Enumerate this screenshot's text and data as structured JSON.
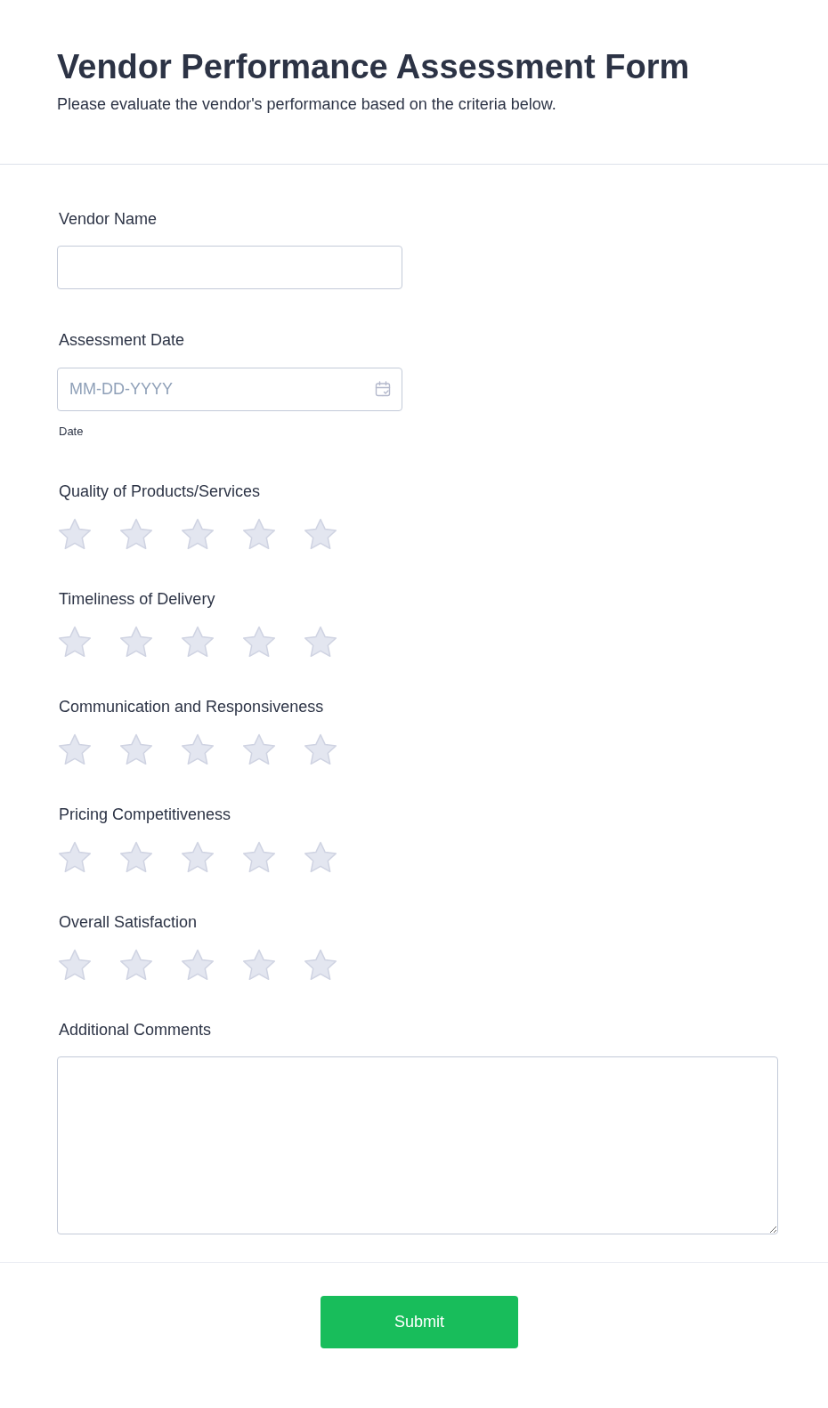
{
  "header": {
    "title": "Vendor Performance Assessment Form",
    "subtitle": "Please evaluate the vendor's performance based on the criteria below."
  },
  "fields": [
    {
      "kind": "text",
      "label": "Vendor Name"
    },
    {
      "kind": "date",
      "label": "Assessment Date",
      "placeholder": "MM-DD-YYYY",
      "sublabel": "Date"
    },
    {
      "kind": "rating",
      "label": "Quality of Products/Services",
      "stars": 0
    },
    {
      "kind": "rating",
      "label": "Timeliness of Delivery",
      "stars": 0
    },
    {
      "kind": "rating",
      "label": "Communication and Responsiveness",
      "stars": 0
    },
    {
      "kind": "rating",
      "label": "Pricing Competitiveness",
      "stars": 0
    },
    {
      "kind": "rating",
      "label": "Overall Satisfaction",
      "stars": 0
    },
    {
      "kind": "textarea",
      "label": "Additional Comments"
    }
  ],
  "submit": {
    "label": "Submit"
  }
}
